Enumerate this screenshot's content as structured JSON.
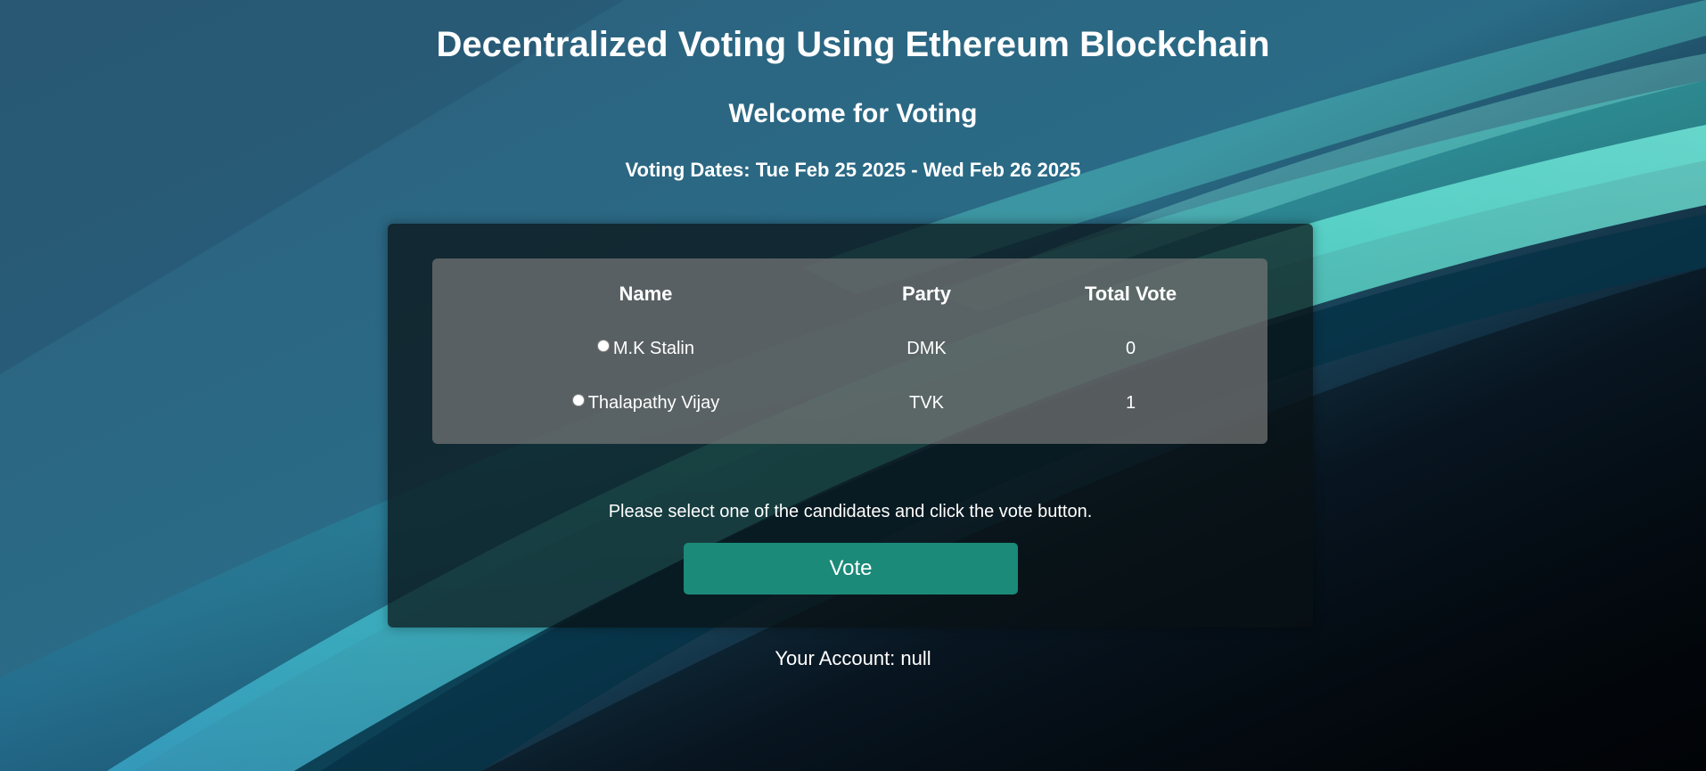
{
  "page": {
    "title": "Decentralized Voting Using Ethereum Blockchain",
    "subtitle": "Welcome for Voting",
    "dates_label": "Voting Dates: Tue Feb 25 2025 - Wed Feb 26 2025"
  },
  "table": {
    "headers": {
      "name": "Name",
      "party": "Party",
      "votes": "Total Vote"
    },
    "rows": [
      {
        "name": "M.K Stalin",
        "party": "DMK",
        "votes": "0"
      },
      {
        "name": "Thalapathy Vijay",
        "party": "TVK",
        "votes": "1"
      }
    ]
  },
  "instructions": "Please select one of the candidates and click the vote button.",
  "vote_button": {
    "label": "Vote",
    "color": "#1b8a78"
  },
  "account": {
    "label": "Your Account: null"
  },
  "colors": {
    "background_dark": "#0a1a26",
    "accent_teal": "#4fe8d2"
  }
}
